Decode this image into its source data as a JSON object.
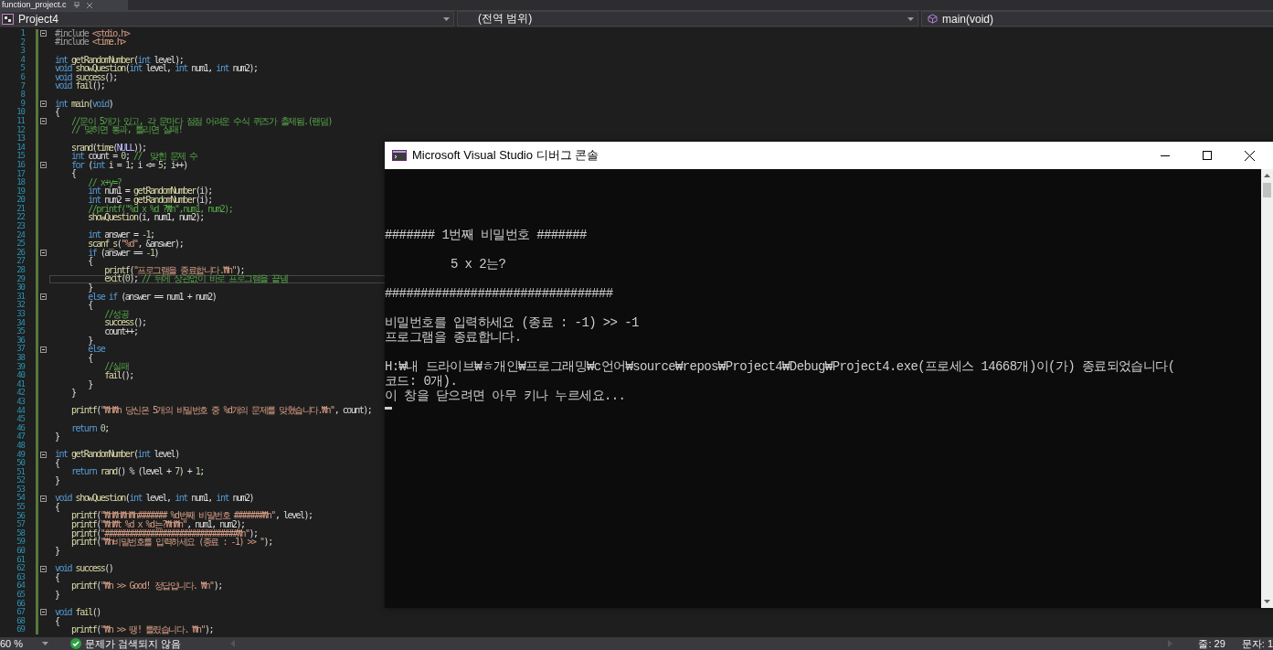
{
  "editor_tab": {
    "title": "function_project.c"
  },
  "navigation_bar": {
    "project": "Project4",
    "scope": "(전역 범위)",
    "member": "main(void)"
  },
  "code_lines": [
    {
      "number": "1",
      "current": false,
      "fold": true,
      "segments": [
        {
          "kind": "preprocessor",
          "text": "#include "
        },
        {
          "kind": "string",
          "text": "<stdio.h>"
        }
      ]
    },
    {
      "number": "2",
      "current": false,
      "segments": [
        {
          "kind": "preprocessor",
          "text": "#include "
        },
        {
          "kind": "string",
          "text": "<time.h>"
        }
      ]
    },
    {
      "number": "3",
      "current": false
    },
    {
      "number": "4",
      "current": false,
      "segments": [
        {
          "kind": "keyword",
          "text": "int "
        },
        {
          "kind": "function",
          "text": "getRandomNumber"
        },
        {
          "kind": "plain",
          "text": "("
        },
        {
          "kind": "keyword",
          "text": "int "
        },
        {
          "kind": "plain",
          "text": "level);"
        }
      ]
    },
    {
      "number": "5",
      "current": false,
      "segments": [
        {
          "kind": "keyword",
          "text": "void "
        },
        {
          "kind": "function",
          "text": "showQuestion"
        },
        {
          "kind": "plain",
          "text": "("
        },
        {
          "kind": "keyword",
          "text": "int "
        },
        {
          "kind": "plain",
          "text": "level, "
        },
        {
          "kind": "keyword",
          "text": "int "
        },
        {
          "kind": "plain",
          "text": "num1, "
        },
        {
          "kind": "keyword",
          "text": "int "
        },
        {
          "kind": "plain",
          "text": "num2);"
        }
      ]
    },
    {
      "number": "6",
      "current": false,
      "segments": [
        {
          "kind": "keyword",
          "text": "void "
        },
        {
          "kind": "function",
          "text": "success"
        },
        {
          "kind": "plain",
          "text": "();"
        }
      ]
    },
    {
      "number": "7",
      "current": false,
      "segments": [
        {
          "kind": "keyword",
          "text": "void "
        },
        {
          "kind": "function",
          "text": "fail"
        },
        {
          "kind": "plain",
          "text": "();"
        }
      ]
    },
    {
      "number": "8",
      "current": false
    },
    {
      "number": "9",
      "current": false,
      "fold": true,
      "segments": [
        {
          "kind": "keyword",
          "text": "int "
        },
        {
          "kind": "function",
          "text": "main"
        },
        {
          "kind": "plain",
          "text": "("
        },
        {
          "kind": "keyword",
          "text": "void"
        },
        {
          "kind": "plain",
          "text": ")"
        }
      ]
    },
    {
      "number": "10",
      "current": false,
      "segments": [
        {
          "kind": "plain",
          "text": "{"
        }
      ]
    },
    {
      "number": "11",
      "current": false,
      "fold": true,
      "segments": [
        {
          "kind": "comment",
          "text": "    //문이 5개가 있고, 각 문마다 점점 어려운 수식 퀴즈가 출제됨.(랜덤)"
        }
      ]
    },
    {
      "number": "12",
      "current": false,
      "segments": [
        {
          "kind": "comment",
          "text": "    // 맞히면 통과, 틀리면 실패!"
        }
      ]
    },
    {
      "number": "13",
      "current": false
    },
    {
      "number": "14",
      "current": false,
      "segments": [
        {
          "kind": "function",
          "text": "    srand"
        },
        {
          "kind": "plain",
          "text": "("
        },
        {
          "kind": "function",
          "text": "time"
        },
        {
          "kind": "plain",
          "text": "("
        },
        {
          "kind": "macro",
          "text": "NULL"
        },
        {
          "kind": "plain",
          "text": "));"
        }
      ]
    },
    {
      "number": "15",
      "current": false,
      "segments": [
        {
          "kind": "keyword",
          "text": "    int "
        },
        {
          "kind": "plain",
          "text": "count = "
        },
        {
          "kind": "number",
          "text": "0"
        },
        {
          "kind": "plain",
          "text": "; "
        },
        {
          "kind": "comment",
          "text": "//  맞힌 문제 수"
        }
      ]
    },
    {
      "number": "16",
      "current": false,
      "fold": true,
      "segments": [
        {
          "kind": "keyword",
          "text": "    for "
        },
        {
          "kind": "plain",
          "text": "("
        },
        {
          "kind": "keyword",
          "text": "int "
        },
        {
          "kind": "plain",
          "text": "i = "
        },
        {
          "kind": "number",
          "text": "1"
        },
        {
          "kind": "plain",
          "text": "; i <= "
        },
        {
          "kind": "number",
          "text": "5"
        },
        {
          "kind": "plain",
          "text": "; i++)"
        }
      ]
    },
    {
      "number": "17",
      "current": false,
      "segments": [
        {
          "kind": "plain",
          "text": "    {"
        }
      ]
    },
    {
      "number": "18",
      "current": false,
      "segments": [
        {
          "kind": "comment",
          "text": "        // x+y=?"
        }
      ]
    },
    {
      "number": "19",
      "current": false,
      "segments": [
        {
          "kind": "keyword",
          "text": "        int "
        },
        {
          "kind": "plain",
          "text": "num1 = "
        },
        {
          "kind": "function",
          "text": "getRandomNumber"
        },
        {
          "kind": "plain",
          "text": "(i);"
        }
      ]
    },
    {
      "number": "20",
      "current": false,
      "segments": [
        {
          "kind": "keyword",
          "text": "        int "
        },
        {
          "kind": "plain",
          "text": "num2 = "
        },
        {
          "kind": "function",
          "text": "getRandomNumber"
        },
        {
          "kind": "plain",
          "text": "(i);"
        }
      ]
    },
    {
      "number": "21",
      "current": false,
      "segments": [
        {
          "kind": "comment",
          "text": "        //printf(\"%d x %d ?₩n\",num1, num2);"
        }
      ]
    },
    {
      "number": "22",
      "current": false,
      "segments": [
        {
          "kind": "function",
          "text": "        showQuestion"
        },
        {
          "kind": "plain",
          "text": "(i, num1, num2);"
        }
      ]
    },
    {
      "number": "23",
      "current": false
    },
    {
      "number": "24",
      "current": false,
      "segments": [
        {
          "kind": "keyword",
          "text": "        int "
        },
        {
          "kind": "plain",
          "text": "answer = "
        },
        {
          "kind": "number",
          "text": "-1"
        },
        {
          "kind": "plain",
          "text": ";"
        }
      ]
    },
    {
      "number": "25",
      "current": false,
      "segments": [
        {
          "kind": "function",
          "text": "        scanf_s"
        },
        {
          "kind": "plain",
          "text": "("
        },
        {
          "kind": "string",
          "text": "\"%d\""
        },
        {
          "kind": "plain",
          "text": ", &answer);"
        }
      ]
    },
    {
      "number": "26",
      "current": false,
      "fold": true,
      "segments": [
        {
          "kind": "keyword",
          "text": "        if "
        },
        {
          "kind": "plain",
          "text": "(answer == "
        },
        {
          "kind": "number",
          "text": "-1"
        },
        {
          "kind": "plain",
          "text": ")"
        }
      ]
    },
    {
      "number": "27",
      "current": false,
      "segments": [
        {
          "kind": "plain",
          "text": "        {"
        }
      ]
    },
    {
      "number": "28",
      "current": false,
      "segments": [
        {
          "kind": "function",
          "text": "            printf"
        },
        {
          "kind": "plain",
          "text": "("
        },
        {
          "kind": "string",
          "text": "\"프로그램을 종료합니다.₩n\""
        },
        {
          "kind": "plain",
          "text": ");"
        }
      ]
    },
    {
      "number": "29",
      "current": true,
      "segments": [
        {
          "kind": "function",
          "text": "            exit"
        },
        {
          "kind": "plain",
          "text": "("
        },
        {
          "kind": "number",
          "text": "0"
        },
        {
          "kind": "plain",
          "text": "); "
        },
        {
          "kind": "comment",
          "text": "// 뒤에 상관없이 바로 프로그램을 끝냄"
        }
      ]
    },
    {
      "number": "30",
      "current": false,
      "segments": [
        {
          "kind": "plain",
          "text": "        }"
        }
      ]
    },
    {
      "number": "31",
      "current": false,
      "fold": true,
      "segments": [
        {
          "kind": "keyword",
          "text": "        else if "
        },
        {
          "kind": "plain",
          "text": "(answer == num1 + num2)"
        }
      ]
    },
    {
      "number": "32",
      "current": false,
      "segments": [
        {
          "kind": "plain",
          "text": "        {"
        }
      ]
    },
    {
      "number": "33",
      "current": false,
      "segments": [
        {
          "kind": "comment",
          "text": "            //성공"
        }
      ]
    },
    {
      "number": "34",
      "current": false,
      "segments": [
        {
          "kind": "function",
          "text": "            success"
        },
        {
          "kind": "plain",
          "text": "();"
        }
      ]
    },
    {
      "number": "35",
      "current": false,
      "segments": [
        {
          "kind": "plain",
          "text": "            count++;"
        }
      ]
    },
    {
      "number": "36",
      "current": false,
      "segments": [
        {
          "kind": "plain",
          "text": "        }"
        }
      ]
    },
    {
      "number": "37",
      "current": false,
      "fold": true,
      "segments": [
        {
          "kind": "keyword",
          "text": "        else"
        }
      ]
    },
    {
      "number": "38",
      "current": false,
      "segments": [
        {
          "kind": "plain",
          "text": "        {"
        }
      ]
    },
    {
      "number": "39",
      "current": false,
      "segments": [
        {
          "kind": "comment",
          "text": "            //실패"
        }
      ]
    },
    {
      "number": "40",
      "current": false,
      "segments": [
        {
          "kind": "function",
          "text": "            fail"
        },
        {
          "kind": "plain",
          "text": "();"
        }
      ]
    },
    {
      "number": "41",
      "current": false,
      "segments": [
        {
          "kind": "plain",
          "text": "        }"
        }
      ]
    },
    {
      "number": "42",
      "current": false,
      "segments": [
        {
          "kind": "plain",
          "text": "    }"
        }
      ]
    },
    {
      "number": "43",
      "current": false
    },
    {
      "number": "44",
      "current": false,
      "segments": [
        {
          "kind": "function",
          "text": "    printf"
        },
        {
          "kind": "plain",
          "text": "("
        },
        {
          "kind": "string",
          "text": "\"₩n₩n 당신은 5개의 비밀번호 중 %d개의 문제를 맞혔습니다.₩n\""
        },
        {
          "kind": "plain",
          "text": ", count);"
        }
      ]
    },
    {
      "number": "45",
      "current": false
    },
    {
      "number": "46",
      "current": false,
      "segments": [
        {
          "kind": "keyword",
          "text": "    return "
        },
        {
          "kind": "number",
          "text": "0"
        },
        {
          "kind": "plain",
          "text": ";"
        }
      ]
    },
    {
      "number": "47",
      "current": false,
      "segments": [
        {
          "kind": "plain",
          "text": "}"
        }
      ]
    },
    {
      "number": "48",
      "current": false
    },
    {
      "number": "49",
      "current": false,
      "fold": true,
      "segments": [
        {
          "kind": "keyword",
          "text": "int "
        },
        {
          "kind": "function",
          "text": "getRandomNumber"
        },
        {
          "kind": "plain",
          "text": "("
        },
        {
          "kind": "keyword",
          "text": "int "
        },
        {
          "kind": "plain",
          "text": "level)"
        }
      ]
    },
    {
      "number": "50",
      "current": false,
      "segments": [
        {
          "kind": "plain",
          "text": "{"
        }
      ]
    },
    {
      "number": "51",
      "current": false,
      "segments": [
        {
          "kind": "keyword",
          "text": "    return "
        },
        {
          "kind": "function",
          "text": "rand"
        },
        {
          "kind": "plain",
          "text": "() % (level + "
        },
        {
          "kind": "number",
          "text": "7"
        },
        {
          "kind": "plain",
          "text": ") + "
        },
        {
          "kind": "number",
          "text": "1"
        },
        {
          "kind": "plain",
          "text": ";"
        }
      ]
    },
    {
      "number": "52",
      "current": false,
      "segments": [
        {
          "kind": "plain",
          "text": "}"
        }
      ]
    },
    {
      "number": "53",
      "current": false
    },
    {
      "number": "54",
      "current": false,
      "fold": true,
      "segments": [
        {
          "kind": "keyword",
          "text": "void "
        },
        {
          "kind": "function",
          "text": "showQuestion"
        },
        {
          "kind": "plain",
          "text": "("
        },
        {
          "kind": "keyword",
          "text": "int "
        },
        {
          "kind": "plain",
          "text": "level, "
        },
        {
          "kind": "keyword",
          "text": "int "
        },
        {
          "kind": "plain",
          "text": "num1, "
        },
        {
          "kind": "keyword",
          "text": "int "
        },
        {
          "kind": "plain",
          "text": "num2)"
        }
      ]
    },
    {
      "number": "55",
      "current": false,
      "segments": [
        {
          "kind": "plain",
          "text": "{"
        }
      ]
    },
    {
      "number": "56",
      "current": false,
      "segments": [
        {
          "kind": "function",
          "text": "    printf"
        },
        {
          "kind": "plain",
          "text": "("
        },
        {
          "kind": "string",
          "text": "\"₩n₩n₩n₩n####### %d번째 비밀번호 #######₩n\""
        },
        {
          "kind": "plain",
          "text": ", level);"
        }
      ]
    },
    {
      "number": "57",
      "current": false,
      "segments": [
        {
          "kind": "function",
          "text": "    printf"
        },
        {
          "kind": "plain",
          "text": "("
        },
        {
          "kind": "string",
          "text": "\"₩n₩t %d x %d는?₩n₩n\""
        },
        {
          "kind": "plain",
          "text": ", num1, num2);"
        }
      ]
    },
    {
      "number": "58",
      "current": false,
      "segments": [
        {
          "kind": "function",
          "text": "    printf"
        },
        {
          "kind": "plain",
          "text": "("
        },
        {
          "kind": "string",
          "text": "\"################################₩n\""
        },
        {
          "kind": "plain",
          "text": ");"
        }
      ]
    },
    {
      "number": "59",
      "current": false,
      "segments": [
        {
          "kind": "function",
          "text": "    printf"
        },
        {
          "kind": "plain",
          "text": "("
        },
        {
          "kind": "string",
          "text": "\"₩n비밀번호를 입력하세요 (종료 : -1) >> \""
        },
        {
          "kind": "plain",
          "text": ");"
        }
      ]
    },
    {
      "number": "60",
      "current": false,
      "segments": [
        {
          "kind": "plain",
          "text": "}"
        }
      ]
    },
    {
      "number": "61",
      "current": false
    },
    {
      "number": "62",
      "current": false,
      "fold": true,
      "segments": [
        {
          "kind": "keyword",
          "text": "void "
        },
        {
          "kind": "function",
          "text": "success"
        },
        {
          "kind": "plain",
          "text": "()"
        }
      ]
    },
    {
      "number": "63",
      "current": false,
      "segments": [
        {
          "kind": "plain",
          "text": "{"
        }
      ]
    },
    {
      "number": "64",
      "current": false,
      "segments": [
        {
          "kind": "function",
          "text": "    printf"
        },
        {
          "kind": "plain",
          "text": "("
        },
        {
          "kind": "string",
          "text": "\"₩n >> Good! 정답입니다. ₩n\""
        },
        {
          "kind": "plain",
          "text": ");"
        }
      ]
    },
    {
      "number": "65",
      "current": false,
      "segments": [
        {
          "kind": "plain",
          "text": "}"
        }
      ]
    },
    {
      "number": "66",
      "current": false
    },
    {
      "number": "67",
      "current": false,
      "fold": true,
      "segments": [
        {
          "kind": "keyword",
          "text": "void "
        },
        {
          "kind": "function",
          "text": "fail"
        },
        {
          "kind": "plain",
          "text": "()"
        }
      ]
    },
    {
      "number": "68",
      "current": false,
      "segments": [
        {
          "kind": "plain",
          "text": "{"
        }
      ]
    },
    {
      "number": "69",
      "current": false,
      "segments": [
        {
          "kind": "function",
          "text": "    printf"
        },
        {
          "kind": "plain",
          "text": "("
        },
        {
          "kind": "string",
          "text": "\"₩n >> 땡! 틀렸습니다. ₩n\""
        },
        {
          "kind": "plain",
          "text": ");"
        }
      ]
    }
  ],
  "console_window": {
    "title": "Microsoft Visual Studio 디버그 콘솔",
    "blocks": [
      {
        "lines": [
          {
            "text": "####### 1번째 비밀번호 #######",
            "indented": false
          }
        ]
      },
      {
        "lines": [
          {
            "text": "5 x 2는?",
            "indented": true
          }
        ]
      },
      {
        "lines": [
          {
            "text": "################################",
            "indented": false
          }
        ]
      },
      {
        "lines": [
          {
            "text": "비밀번호를 입력하세요 (종료 : -1) >> -1",
            "indented": false
          },
          {
            "text": "프로그램을 종료합니다.",
            "indented": false
          }
        ]
      },
      {
        "lines": [
          {
            "text": "H:₩내 드라이브₩ㅎ개인₩프로그래밍₩c언어₩source₩repos₩Project4₩Debug₩Project4.exe(프로세스 14668개)이(가) 종료되었습니다(",
            "indented": false
          },
          {
            "text": "코드: 0개).",
            "indented": false
          },
          {
            "text": "이 창을 닫으려면 아무 키나 누르세요...",
            "indented": false
          }
        ]
      }
    ]
  },
  "status_bar": {
    "zoom": "60 %",
    "issues": "문제가 검색되지 않음",
    "line": "줄: 29",
    "column": "문자: 1"
  }
}
